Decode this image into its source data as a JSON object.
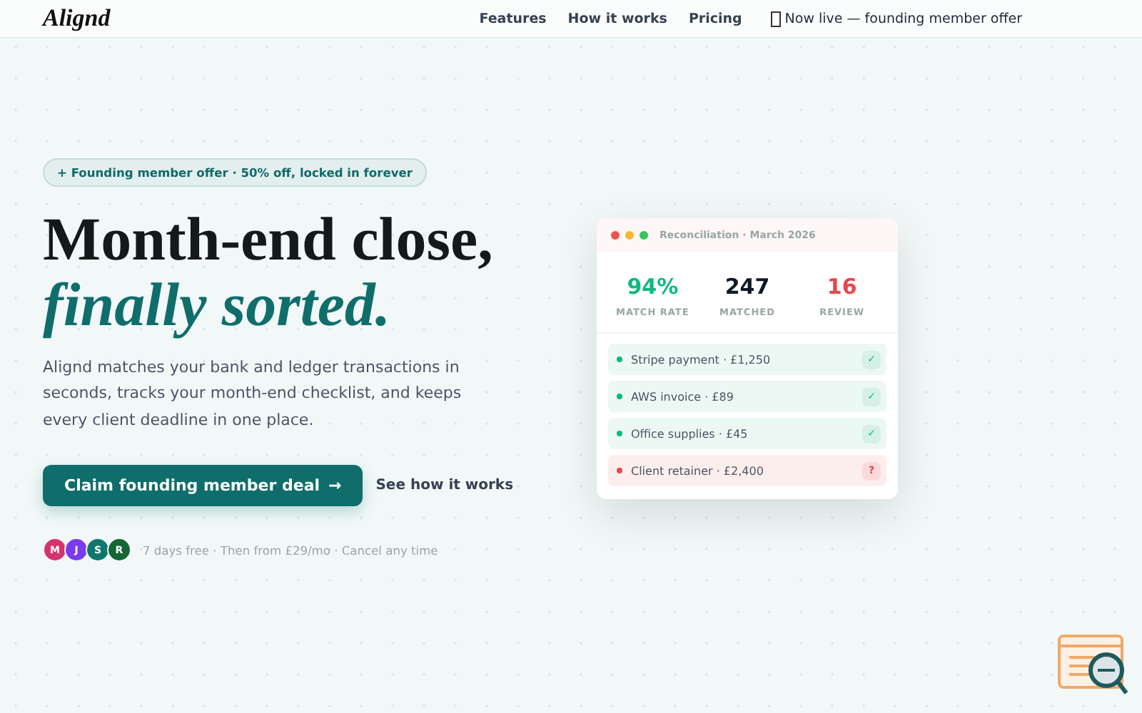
{
  "header": {
    "logo": "Alignd",
    "nav": [
      {
        "label": "Features"
      },
      {
        "label": "How it works"
      },
      {
        "label": "Pricing"
      }
    ],
    "announcement": "Now live — founding member offer"
  },
  "hero": {
    "pill": "+ Founding member offer · 50% off, locked in forever",
    "headline": "Month-end close,",
    "headline_accent": "finally sorted.",
    "description": "Alignd matches your bank and ledger transactions in seconds, tracks your month-end checklist, and keeps every client deadline in one place.",
    "primary_button": "Claim founding member deal",
    "primary_arrow": "→",
    "secondary_link": "See how it works",
    "avatars": [
      {
        "initial": "M",
        "color": "#d6336c"
      },
      {
        "initial": "J",
        "color": "#7c3aed"
      },
      {
        "initial": "S",
        "color": "#0f766e"
      },
      {
        "initial": "R",
        "color": "#166534"
      }
    ],
    "fine_print": "7 days free · Then from £29/mo · Cancel any time"
  },
  "card": {
    "title": "Reconciliation · March 2026",
    "stats": [
      {
        "value": "94%",
        "label": "MATCH RATE",
        "color": "#10b981"
      },
      {
        "value": "247",
        "label": "MATCHED",
        "color": "#111827"
      },
      {
        "value": "16",
        "label": "REVIEW",
        "color": "#e5484d"
      }
    ],
    "rows": [
      {
        "text": "Stripe payment · £1,250",
        "kind": "matched",
        "badge": "✓"
      },
      {
        "text": "AWS invoice · £89",
        "kind": "matched",
        "badge": "✓"
      },
      {
        "text": "Office supplies · £45",
        "kind": "matched",
        "badge": "✓"
      },
      {
        "text": "Client retainer · £2,400",
        "kind": "review",
        "badge": "?"
      }
    ]
  }
}
